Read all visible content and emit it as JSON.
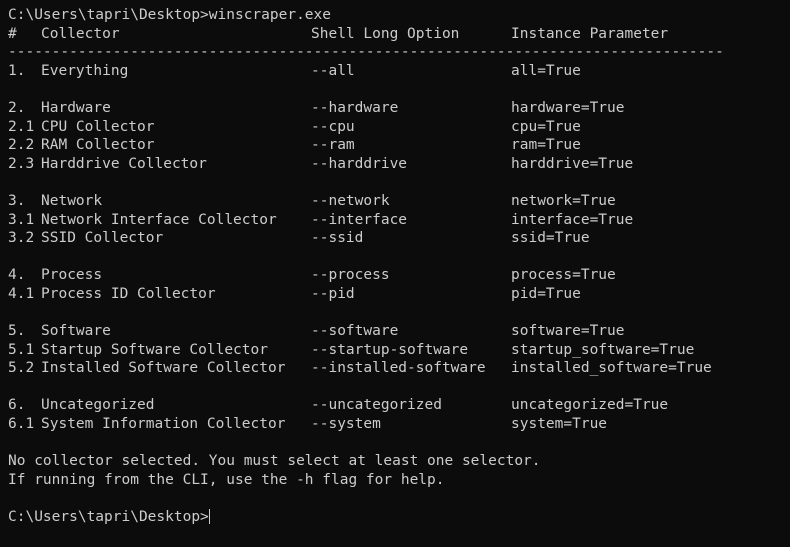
{
  "terminal": {
    "background_color": "#0c0c0c",
    "text_color": "#cccccc",
    "prompt_command_line": "C:\\Users\\tapri\\Desktop>winscraper.exe",
    "separator": "----------------------------------------------------------------------------------",
    "headers": {
      "number": "#",
      "collector": "Collector",
      "shell_long_option": "Shell Long Option",
      "instance_parameter": "Instance Parameter"
    },
    "rows": [
      {
        "num": "1.",
        "name": "Everything",
        "option": "--all",
        "param": "all=True"
      },
      {
        "blank": true
      },
      {
        "num": "2.",
        "name": "Hardware",
        "option": "--hardware",
        "param": "hardware=True"
      },
      {
        "num": "2.1",
        "name": "CPU Collector",
        "option": "--cpu",
        "param": "cpu=True"
      },
      {
        "num": "2.2",
        "name": "RAM Collector",
        "option": "--ram",
        "param": "ram=True"
      },
      {
        "num": "2.3",
        "name": "Harddrive Collector",
        "option": "--harddrive",
        "param": "harddrive=True"
      },
      {
        "blank": true
      },
      {
        "num": "3.",
        "name": "Network",
        "option": "--network",
        "param": "network=True"
      },
      {
        "num": "3.1",
        "name": "Network Interface Collector",
        "option": "--interface",
        "param": "interface=True"
      },
      {
        "num": "3.2",
        "name": "SSID Collector",
        "option": "--ssid",
        "param": "ssid=True"
      },
      {
        "blank": true
      },
      {
        "num": "4.",
        "name": "Process",
        "option": "--process",
        "param": "process=True"
      },
      {
        "num": "4.1",
        "name": "Process ID Collector",
        "option": "--pid",
        "param": "pid=True"
      },
      {
        "blank": true
      },
      {
        "num": "5.",
        "name": "Software",
        "option": "--software",
        "param": "software=True"
      },
      {
        "num": "5.1",
        "name": "Startup Software Collector",
        "option": "--startup-software",
        "param": "startup_software=True"
      },
      {
        "num": "5.2",
        "name": "Installed Software Collector",
        "option": "--installed-software",
        "param": "installed_software=True"
      },
      {
        "blank": true
      },
      {
        "num": "6.",
        "name": "Uncategorized",
        "option": "--uncategorized",
        "param": "uncategorized=True"
      },
      {
        "num": "6.1",
        "name": "System Information Collector",
        "option": "--system",
        "param": "system=True"
      }
    ],
    "messages": [
      "No collector selected. You must select at least one selector.",
      "If running from the CLI, use the -h flag for help."
    ],
    "final_prompt": "C:\\Users\\tapri\\Desktop>"
  }
}
